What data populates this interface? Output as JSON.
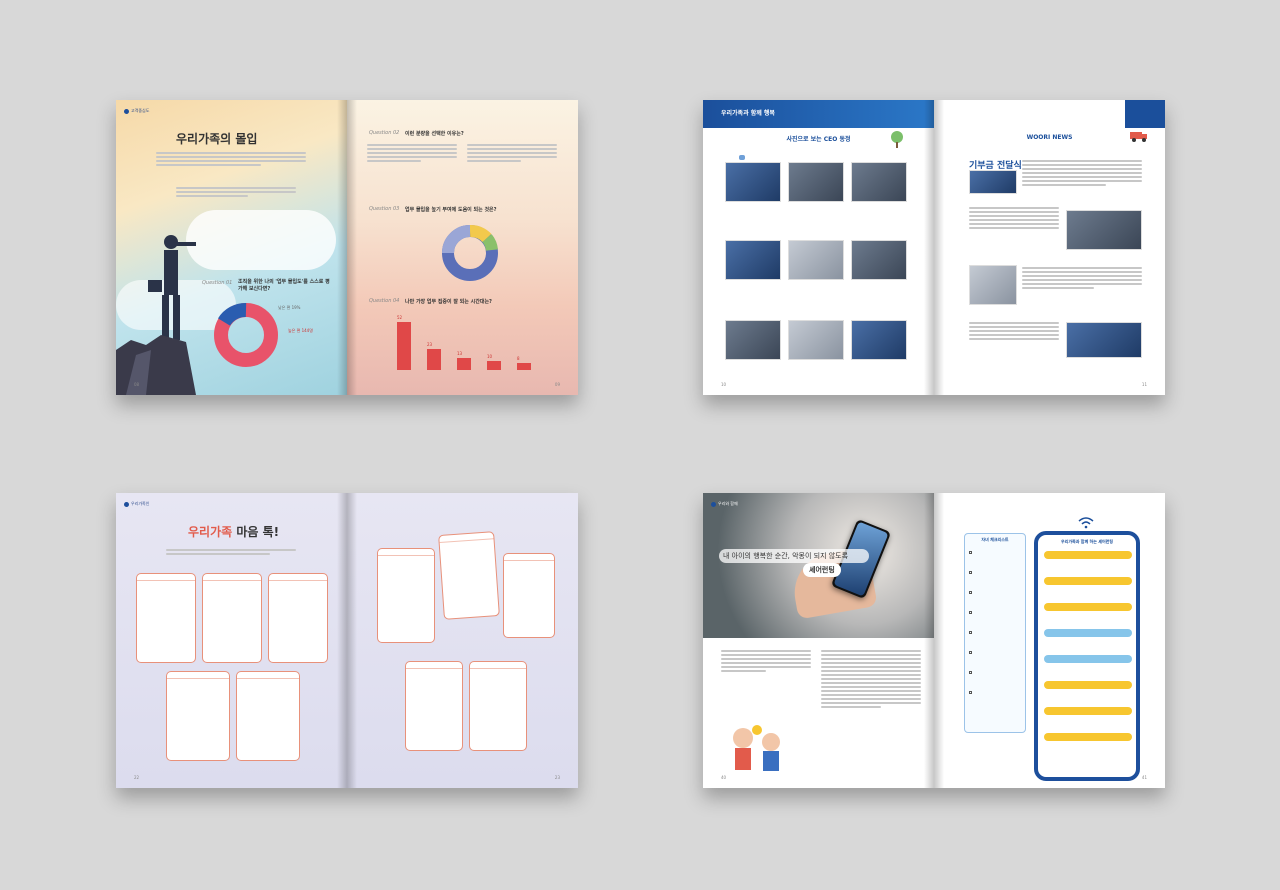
{
  "spread1": {
    "brand": "고객중심도",
    "title": "우리가족의 몰입",
    "q01_label": "Question 01",
    "q01_text": "조직을 위한 나의 '업무 몰입도'를 스스로 평가해 보신다면?",
    "q02_label": "Question 02",
    "q02_text": "이런 분량을 선택한 이유는?",
    "q03_label": "Question 03",
    "q03_text": "업무 몰입을 높기 부여에 도움이 되는 것은?",
    "q04_label": "Question 04",
    "q04_text": "나만 가장 업무 집중이 잘 되는 시간대는?",
    "donut_low": "높은 편 144명",
    "donut_high": "낮은 편 19%",
    "bars": [
      {
        "value": 52
      },
      {
        "value": 23
      },
      {
        "value": 13
      },
      {
        "value": 10
      },
      {
        "value": 8
      }
    ],
    "page_left": "08",
    "page_right": "09"
  },
  "spread2": {
    "brand": "우리가족과 함께 행복",
    "left_title": "사진으로 보는 CEO 동정",
    "right_title": "WOORI NEWS",
    "headline": "기부금 전달식",
    "page_left": "10",
    "page_right": "11"
  },
  "spread3": {
    "brand": "우리가족인",
    "title_red": "우리가족",
    "title_dark": "마음 톡!",
    "page_left": "22",
    "page_right": "23"
  },
  "spread4": {
    "brand": "우리와 함께",
    "caption": "내 아이의 행복한 순간, 악몽이 되지 않도록",
    "tag": "셰어런팅",
    "checklist_title": "자녀 체크리스트",
    "mobile_title": "우리가족과 함께 하는 셰어런팅",
    "page_left": "40",
    "page_right": "41"
  },
  "colors": {
    "background": "#d8d8d8",
    "accent_blue": "#1b4f9b",
    "accent_red": "#e04848",
    "accent_coral": "#e25b4b",
    "accent_yellow": "#f7c62f"
  }
}
